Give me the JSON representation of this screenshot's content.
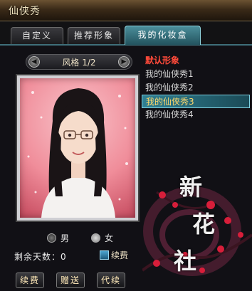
{
  "window": {
    "title": "仙侠秀"
  },
  "tabs": [
    {
      "label": "自定义"
    },
    {
      "label": "推荐形象"
    },
    {
      "label": "我的化妆盒",
      "active": true
    }
  ],
  "style": {
    "label": "风格 1/2"
  },
  "gender": {
    "male": "男",
    "female": "女",
    "selected": "female"
  },
  "days": {
    "text": "剩余天数：0"
  },
  "renew_checkbox": {
    "label": "续费",
    "checked": true
  },
  "buttons": {
    "renew": "续费",
    "gift": "赠送",
    "proxy_renew": "代续"
  },
  "list": {
    "items": [
      {
        "label": "默认形象",
        "kind": "default"
      },
      {
        "label": "我的仙侠秀1"
      },
      {
        "label": "我的仙侠秀2"
      },
      {
        "label": "我的仙侠秀3",
        "selected": true
      },
      {
        "label": "我的仙侠秀4"
      }
    ]
  },
  "watermark": {
    "chars": [
      "新",
      "花",
      "社"
    ]
  },
  "colors": {
    "accent": "#2f7f92",
    "default_item": "#ff4a3a",
    "selected_text": "#ffd86b"
  }
}
